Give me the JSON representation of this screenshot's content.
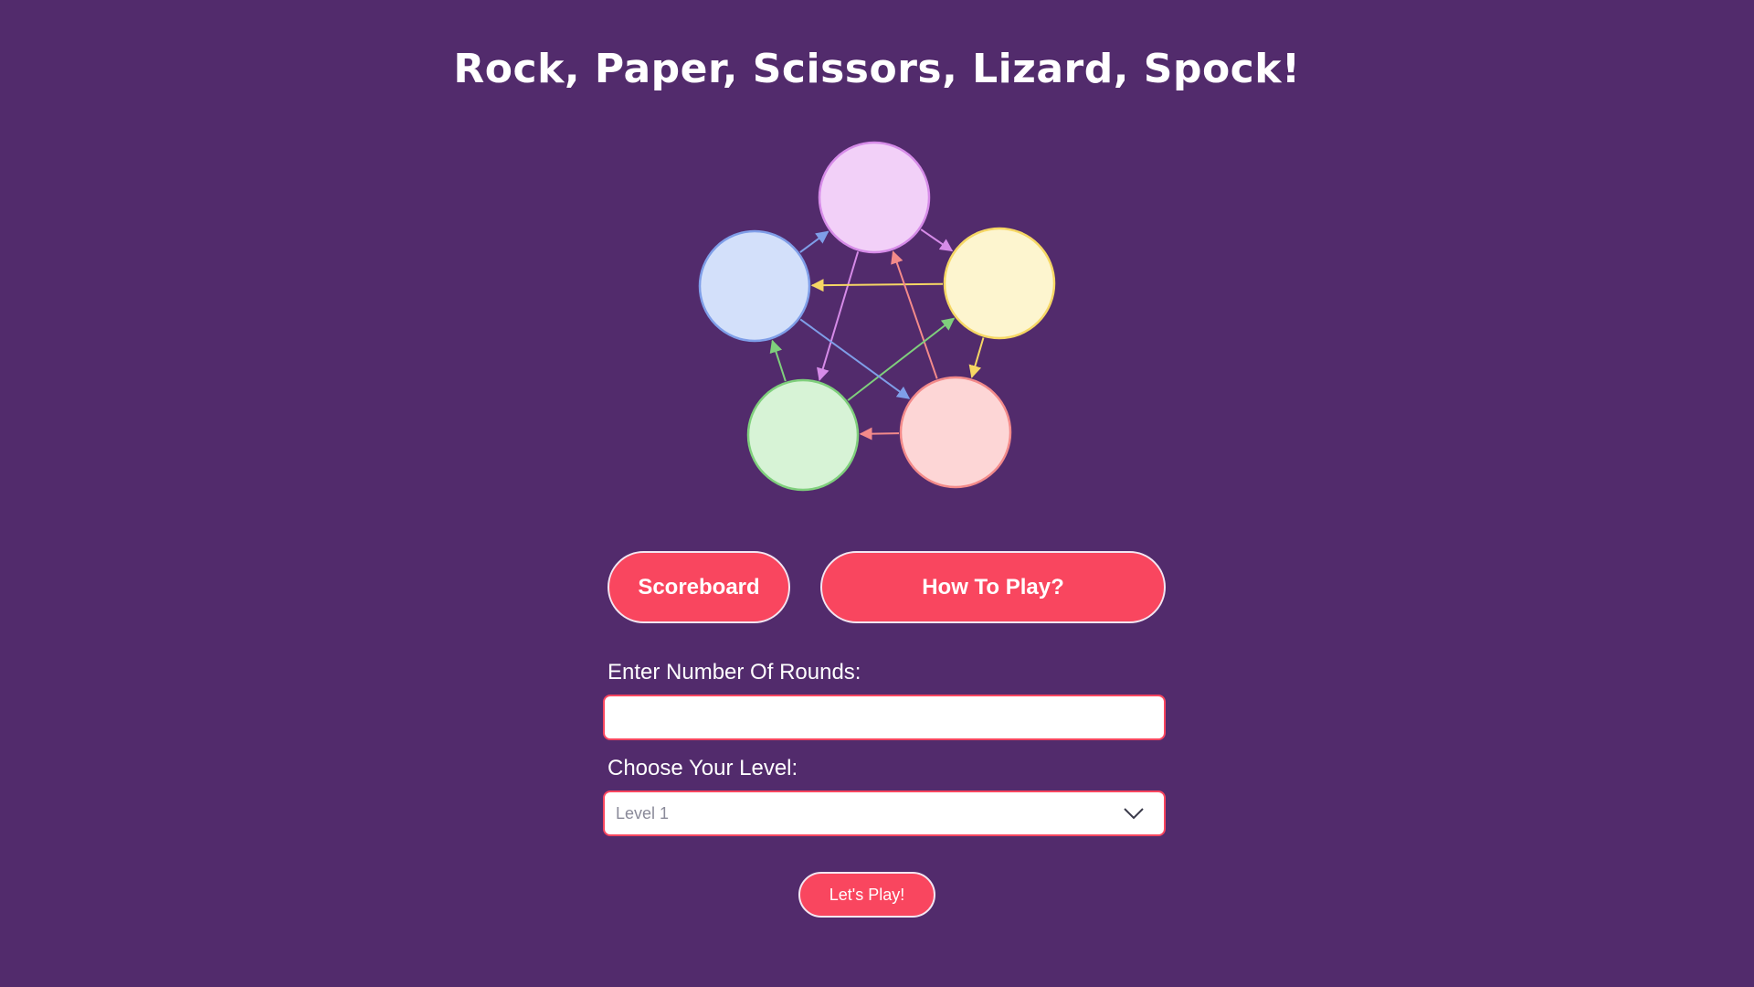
{
  "title": "Rock, Paper, Scissors, Lizard, Spock!",
  "diagram": {
    "nodes": [
      {
        "id": "scissors",
        "icon": "scissors-hand-icon",
        "fill": "#f2d0f8",
        "stroke": "#d68be8"
      },
      {
        "id": "paper",
        "icon": "paper-hand-icon",
        "fill": "#fdf5cf",
        "stroke": "#f6d764"
      },
      {
        "id": "rock",
        "icon": "rock-hand-icon",
        "fill": "#fdd6d6",
        "stroke": "#f38a8a"
      },
      {
        "id": "lizard",
        "icon": "lizard-hand-icon",
        "fill": "#d7f3d6",
        "stroke": "#7fcf7c"
      },
      {
        "id": "spock",
        "icon": "spock-hand-icon",
        "fill": "#d3e0fa",
        "stroke": "#7f9ee8"
      }
    ],
    "arrows": [
      {
        "from": "scissors",
        "to": "paper",
        "color": "#d68be8"
      },
      {
        "from": "scissors",
        "to": "lizard",
        "color": "#d68be8"
      },
      {
        "from": "paper",
        "to": "rock",
        "color": "#f6d764"
      },
      {
        "from": "paper",
        "to": "spock",
        "color": "#f6d764"
      },
      {
        "from": "rock",
        "to": "lizard",
        "color": "#f38a8a"
      },
      {
        "from": "rock",
        "to": "scissors",
        "color": "#f38a8a"
      },
      {
        "from": "lizard",
        "to": "spock",
        "color": "#7fcf7c"
      },
      {
        "from": "lizard",
        "to": "paper",
        "color": "#7fcf7c"
      },
      {
        "from": "spock",
        "to": "scissors",
        "color": "#7f9ee8"
      },
      {
        "from": "spock",
        "to": "rock",
        "color": "#7f9ee8"
      }
    ]
  },
  "buttons": {
    "scoreboard": "Scoreboard",
    "how_to_play": "How To Play?",
    "play": "Let's Play!"
  },
  "form": {
    "rounds_label": "Enter Number Of Rounds:",
    "rounds_value": "",
    "level_label": "Choose Your Level:",
    "level_value": "Level 1"
  },
  "colors": {
    "background": "#522b6c",
    "accent": "#f9465f"
  }
}
